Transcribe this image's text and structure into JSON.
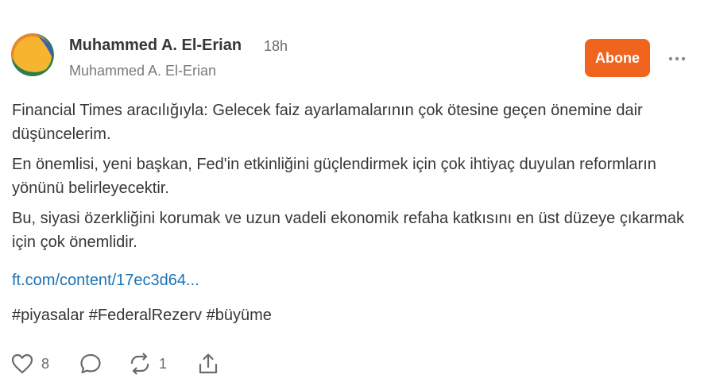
{
  "post": {
    "author_name": "Muhammed A. El-Erian",
    "author_handle": "Muhammed A. El-Erian",
    "time": "18h",
    "subscribe_label": "Abone",
    "paragraphs": [
      "Financial Times aracılığıyla: Gelecek faiz ayarlamalarının çok ötesine geçen önemine dair düşüncelerim.",
      "En önemlisi, yeni başkan, Fed'in etkinliğini güçlendirmek için çok ihtiyaç duyulan reformların yönünü belirleyecektir.",
      "Bu, siyasi özerkliğini korumak ve uzun vadeli ekonomik refaha katkısını en üst düzeye çıkarmak için çok önemlidir."
    ],
    "link_text": "ft.com/content/17ec3d64...",
    "hashtags": [
      "#piyasalar",
      "#FederalRezerv",
      "#büyüme"
    ],
    "actions": {
      "like_icon": "heart-icon",
      "like_count": "8",
      "comment_icon": "comment-icon",
      "restack_icon": "restack-icon",
      "restack_count": "1",
      "share_icon": "share-icon"
    },
    "colors": {
      "subscribe_bg": "#f1641e",
      "link": "#1b73b4",
      "text": "#363737",
      "muted": "#6b6b6b"
    }
  }
}
